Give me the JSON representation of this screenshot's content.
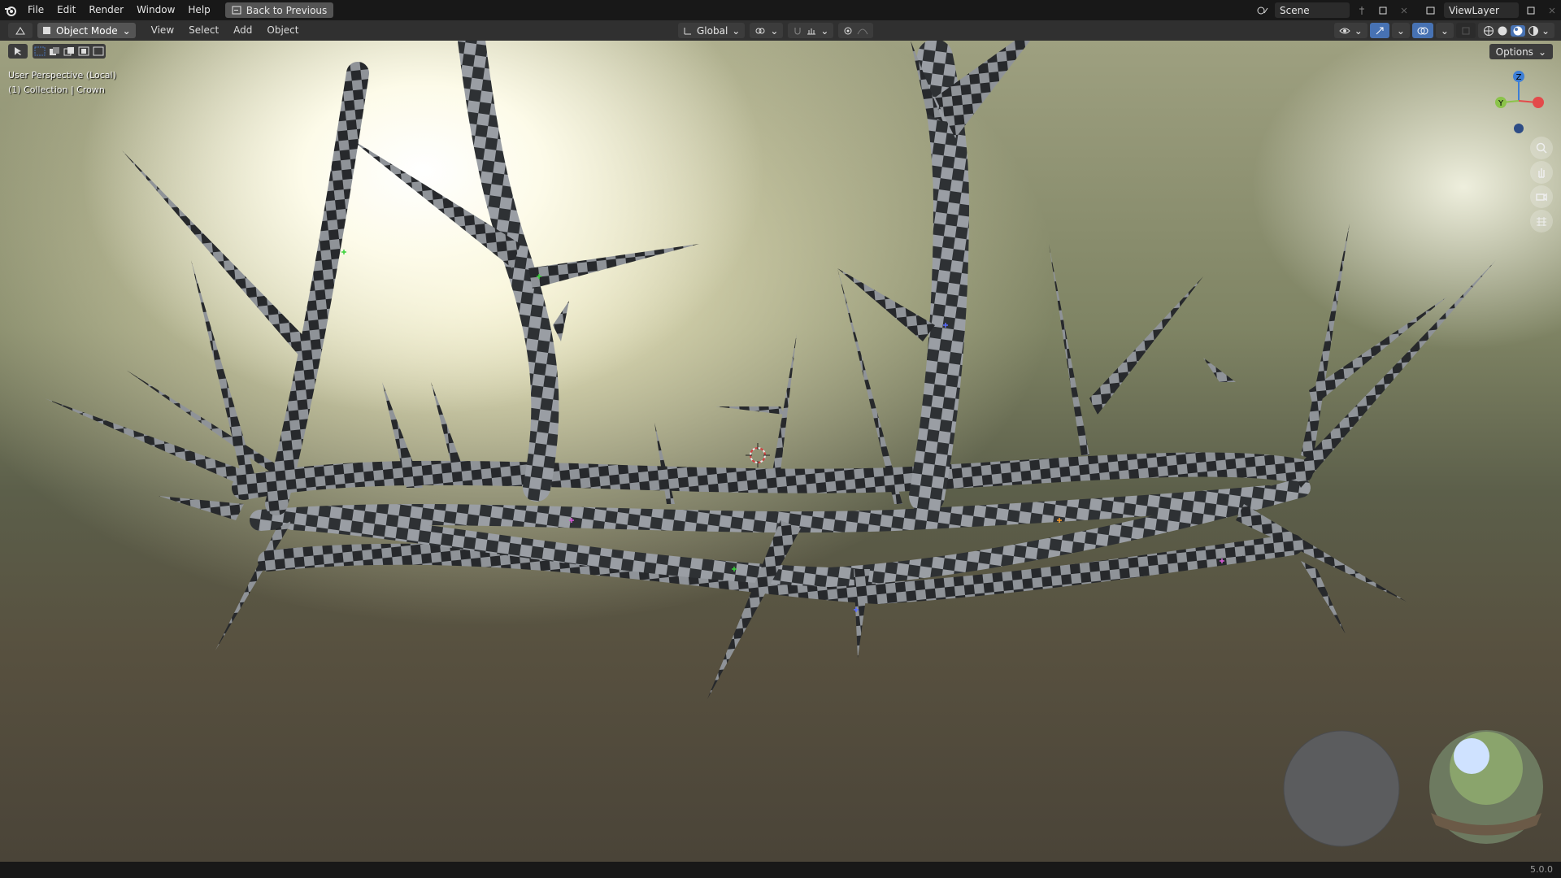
{
  "topbar": {
    "menu": [
      "File",
      "Edit",
      "Render",
      "Window",
      "Help"
    ],
    "back_label": "Back to Previous",
    "scene": "Scene",
    "view_layer": "ViewLayer"
  },
  "header": {
    "mode": "Object Mode",
    "menus": [
      "View",
      "Select",
      "Add",
      "Object"
    ],
    "transform_orientation": "Global",
    "options": "Options"
  },
  "viewport": {
    "perspective": "User Perspective (Local)",
    "collection": "(1) Collection | Crown",
    "gizmo": {
      "x": "X",
      "y": "Y",
      "z": "Z"
    }
  },
  "status": {
    "version": "5.0.0"
  },
  "icons": [
    "blender-logo-icon",
    "back-icon",
    "scene-icon",
    "pin-icon",
    "new-scene-icon",
    "view-layer-icon",
    "cursor-icon",
    "select-box-icon",
    "global-orientation-icon",
    "pivot-icon",
    "snap-icon",
    "proportional-icon",
    "overlay-icon",
    "gizmo-icon",
    "wireframe-shading-icon",
    "solid-shading-icon",
    "material-shading-icon",
    "rendered-shading-icon",
    "zoom-icon",
    "pan-icon",
    "camera-icon",
    "grid-icon",
    "3d-cursor-icon"
  ],
  "colors": {
    "topbar": "#181818",
    "header": "#303030",
    "accent": "#4772b3",
    "axis_x": "#e34a4a",
    "axis_y": "#8bc34a",
    "axis_z": "#3d7ed6"
  }
}
